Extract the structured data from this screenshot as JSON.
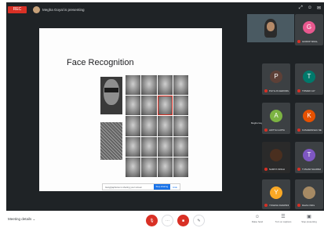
{
  "top": {
    "rec_label": "REC",
    "presenter_text": "Megha Goyal is presenting",
    "icons": [
      "expand-icon",
      "people-icon",
      "chat-icon"
    ]
  },
  "slide": {
    "title": "Face Recognition",
    "banner_message": "Ganglyaphotos is sharing your screen",
    "stop_label": "Stop sharing",
    "hide_label": "Hide"
  },
  "participants": [
    {
      "initial": "",
      "name": "Megha Goyal",
      "color": ""
    },
    {
      "initial": "G",
      "name": "GURDIP SINGH",
      "color": "#e8588e"
    },
    {
      "initial": "P",
      "name": "PHYLLIS GERONIMO",
      "color": "#5d4037"
    },
    {
      "initial": "T",
      "name": "TRIVEDI JAY",
      "color": "#00796b"
    },
    {
      "initial": "A",
      "name": "ADITYA GUPTA",
      "color": "#7cb342"
    },
    {
      "initial": "K",
      "name": "KUSHWANSHU NEGI",
      "color": "#e65100"
    },
    {
      "initial": "",
      "name": "NAMITA SINGH",
      "color": ""
    },
    {
      "initial": "T",
      "name": "TUSHAR SHARMA",
      "color": "#7e57c2"
    },
    {
      "initial": "Y",
      "name": "YOGESH DHARSNE",
      "color": "#f9a825"
    },
    {
      "initial": "",
      "name": "Rashmi Mitra",
      "color": ""
    }
  ],
  "bottom": {
    "meeting_details": "Meeting details",
    "controls": [
      "mic-off-icon",
      "more-icon",
      "camera-off-icon",
      "present-icon"
    ],
    "right_controls": [
      {
        "icon": "☺",
        "label": "Raise hand"
      },
      {
        "icon": "☰",
        "label": "Turn on captions"
      },
      {
        "icon": "▣",
        "label": "Stop presenting"
      }
    ]
  }
}
